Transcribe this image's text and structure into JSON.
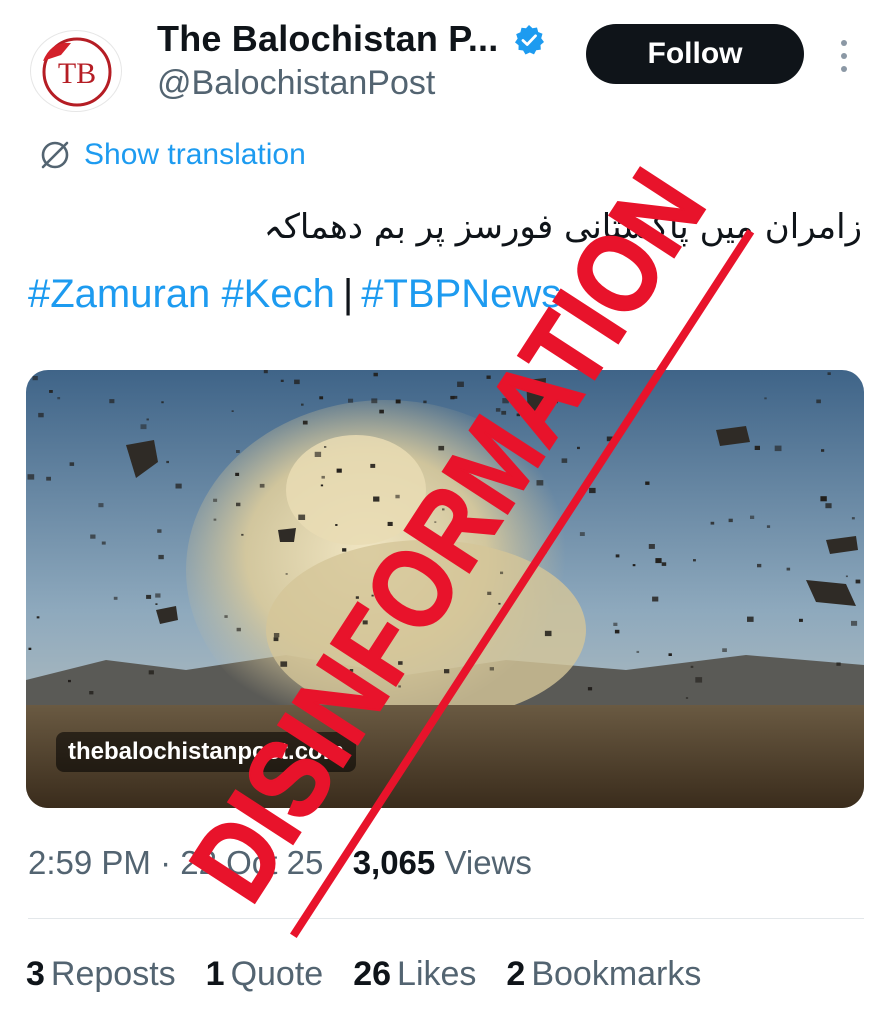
{
  "account": {
    "display_name": "The Balochistan P...",
    "handle": "@BalochistanPost",
    "avatar_text": "TB",
    "verified": true
  },
  "actions": {
    "follow_label": "Follow"
  },
  "translation": {
    "label": "Show translation"
  },
  "tweet": {
    "text_urdu": "زامران میں پاکستانی فورسز پر بم دھماکہ",
    "hashtags": [
      "#Zamuran",
      "#Kech",
      "#TBPNews"
    ],
    "separator": "|"
  },
  "media": {
    "watermark": "thebalochistanpost.com",
    "description_icon": "explosion-photo"
  },
  "meta": {
    "time": "2:59 PM",
    "date": "22 Oct 25",
    "dot": "·",
    "views_count": "3,065",
    "views_label": "Views"
  },
  "stats": [
    {
      "count": "3",
      "label": "Reposts"
    },
    {
      "count": "1",
      "label": "Quote"
    },
    {
      "count": "26",
      "label": "Likes"
    },
    {
      "count": "2",
      "label": "Bookmarks"
    }
  ],
  "overlay": {
    "stamp_text": "DISINFORMATION",
    "stamp_color": "#e8132b"
  },
  "colors": {
    "link": "#1d9bf0",
    "muted": "#536471",
    "text": "#0f1419",
    "verified": "#1d9bf0"
  }
}
